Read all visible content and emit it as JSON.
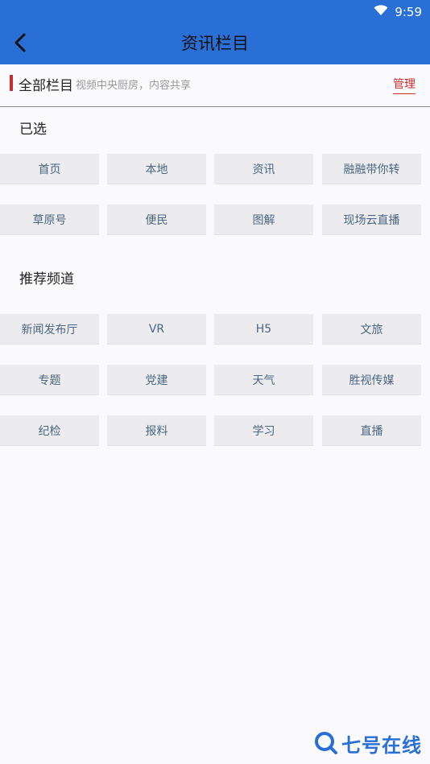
{
  "status_bar": {
    "time": "9:59",
    "icons": [
      "wifi-icon"
    ]
  },
  "header": {
    "title": "资讯栏目",
    "back_icon": "chevron-left-icon"
  },
  "section": {
    "title": "全部栏目",
    "subtitle": "视频中央厨房，内容共享",
    "manage_label": "管理",
    "accent_color": "#c9302c"
  },
  "selected": {
    "heading": "已选",
    "items": [
      "首页",
      "本地",
      "资讯",
      "融融带你转",
      "草原号",
      "便民",
      "图解",
      "现场云直播"
    ]
  },
  "recommended": {
    "heading": "推荐频道",
    "items": [
      "新闻发布厅",
      "VR",
      "H5",
      "文旅",
      "专题",
      "党建",
      "天气",
      "胜视传媒",
      "纪检",
      "报料",
      "学习",
      "直播"
    ]
  },
  "watermark": {
    "text": "七号在线"
  },
  "colors": {
    "brand_blue": "#2a6fd6",
    "chip_bg": "#ececee",
    "chip_text": "#4a6785"
  }
}
